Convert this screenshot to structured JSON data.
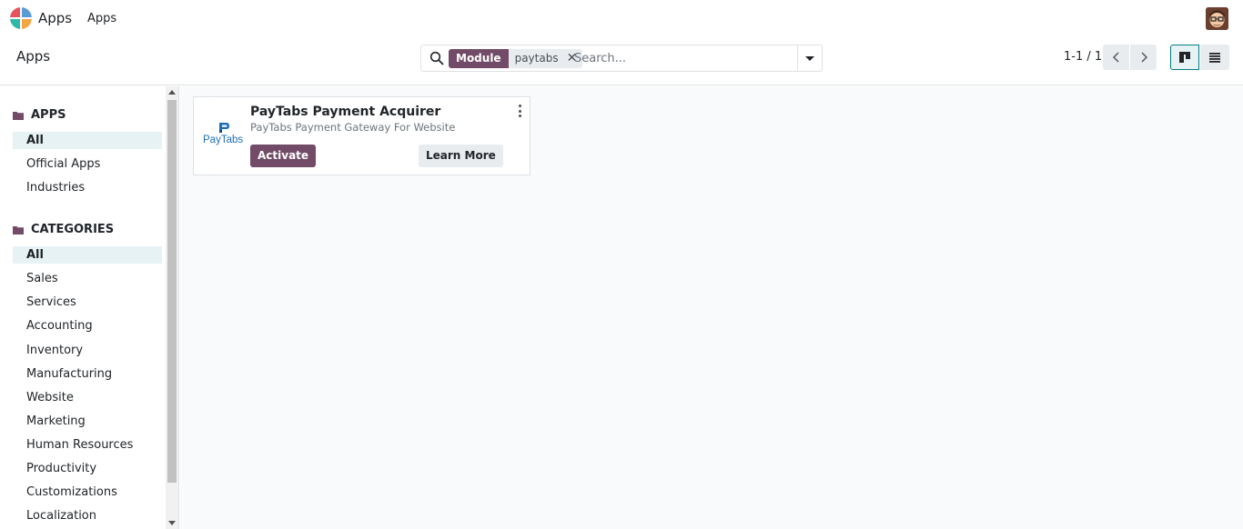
{
  "navbar": {
    "app_name": "Apps",
    "menu_item": "Apps"
  },
  "control": {
    "breadcrumb": "Apps",
    "search": {
      "facet_label": "Module",
      "facet_value": "paytabs",
      "placeholder": "Search..."
    },
    "pager": {
      "value": "1-1 / 1"
    }
  },
  "sidebar": {
    "apps_header": "APPS",
    "apps_items": [
      "All",
      "Official Apps",
      "Industries"
    ],
    "categories_header": "CATEGORIES",
    "categories_items": [
      "All",
      "Sales",
      "Services",
      "Accounting",
      "Inventory",
      "Manufacturing",
      "Website",
      "Marketing",
      "Human Resources",
      "Productivity",
      "Customizations",
      "Localization"
    ]
  },
  "card": {
    "title": "PayTabs Payment Acquirer",
    "subtitle": "PayTabs Payment Gateway For Website",
    "logo_text": "PayTabs",
    "activate_label": "Activate",
    "learn_more_label": "Learn More"
  },
  "colors": {
    "brand": "#714b67",
    "active_bg": "#e6f2f3",
    "paytabs_blue": "#1f6fb5"
  }
}
